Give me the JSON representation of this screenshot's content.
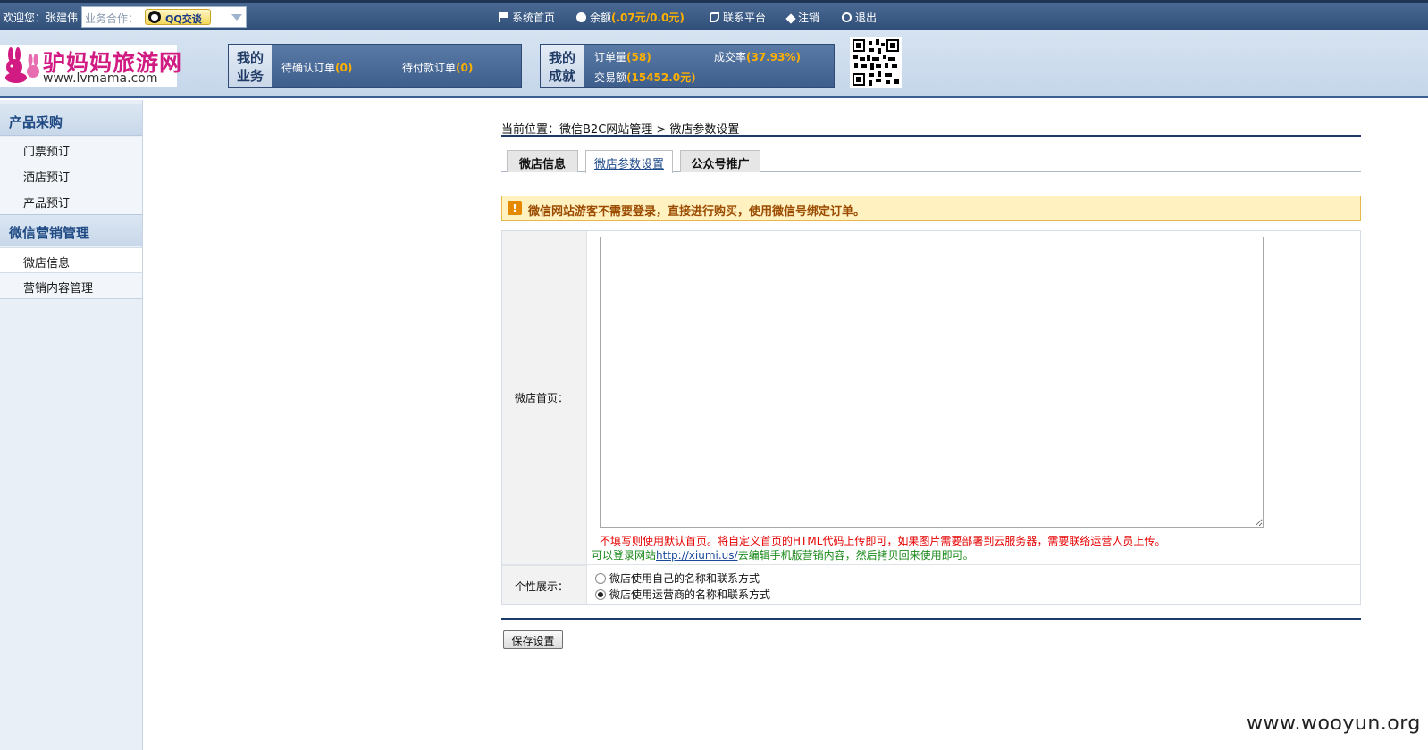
{
  "topbar": {
    "welcome": "欢迎您：张建伟",
    "partner_placeholder": "业务合作：",
    "qq_label": "QQ交谈",
    "nav": {
      "home": "系统首页",
      "balance_label": "余额",
      "balance_value": "(.07元/0.0元)",
      "contact": "联系平台",
      "logout": "注销",
      "exit": "退出"
    }
  },
  "header": {
    "logo_cn": "驴妈妈旅游网",
    "logo_en": "www.lvmama.com",
    "business": {
      "title": "我的业务",
      "pending_confirm_label": "待确认订单",
      "pending_confirm_value": "(0)",
      "pending_pay_label": "待付款订单",
      "pending_pay_value": "(0)"
    },
    "achievement": {
      "title": "我的成就",
      "orders_label": "订单量",
      "orders_value": "(58)",
      "rate_label": "成交率",
      "rate_value": "(37.93%)",
      "amount_label": "交易额",
      "amount_value": "(15452.0元)"
    }
  },
  "sidebar": {
    "groups": [
      {
        "title": "产品采购",
        "items": [
          "门票预订",
          "酒店预订",
          "产品预订"
        ]
      },
      {
        "title": "微信营销管理",
        "items": [
          "微店信息",
          "营销内容管理"
        ]
      }
    ],
    "active_item": "微店信息"
  },
  "main": {
    "breadcrumb": "当前位置：微信B2C网站管理 > 微店参数设置",
    "tabs": [
      "微店信息",
      "微店参数设置",
      "公众号推广"
    ],
    "active_tab": "微店参数设置",
    "notice": "微信网站游客不需要登录，直接进行购买，使用微信号绑定订单。",
    "homepage_label": "微店首页：",
    "homepage_value": "",
    "hint_red": "不填写则使用默认首页。将自定义首页的HTML代码上传即可，如果图片需要部署到云服务器，需要联络运营人员上传。",
    "hint_green_prefix": "可以登录网站",
    "hint_green_link": "http://xiumi.us/",
    "hint_green_suffix": "去编辑手机版营销内容，然后拷贝回来使用即可。",
    "display_label": "个性展示：",
    "radio_options": [
      "微店使用自己的名称和联系方式",
      "微店使用运营商的名称和联系方式"
    ],
    "radio_selected": 1,
    "save_button": "保存设置"
  },
  "watermark": "www.wooyun.org"
}
